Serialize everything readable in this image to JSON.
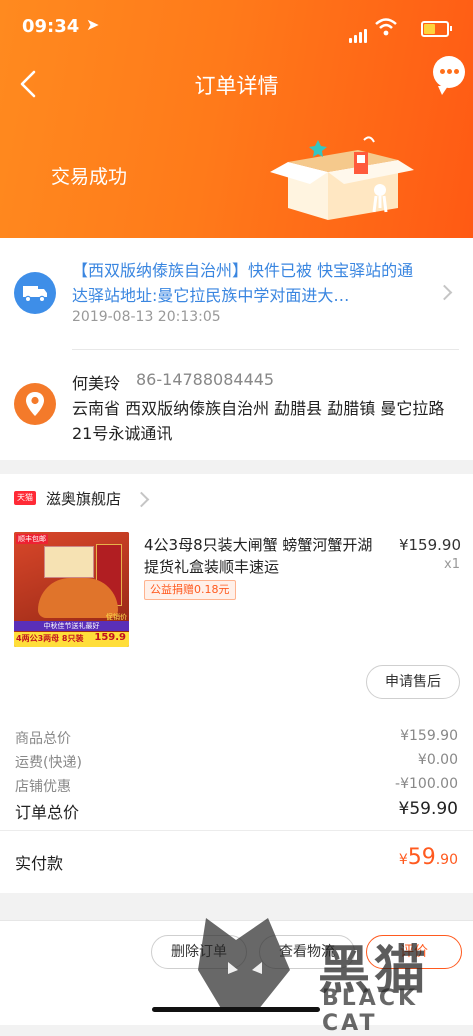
{
  "status_bar": {
    "time": "09:34",
    "location_glyph": "➤"
  },
  "header": {
    "title": "订单详情",
    "deal_status": "交易成功"
  },
  "logistics": {
    "message": "【西双版纳傣族自治州】快件已被 快宝驿站的通达驿站地址:曼它拉民族中学对面进大…",
    "time": "2019-08-13 20:13:05"
  },
  "address": {
    "name": "何美玲",
    "phone": "86-14788084445",
    "detail": "云南省 西双版纳傣族自治州 勐腊县 勐腊镇 曼它拉路21号永诚通讯"
  },
  "shop": {
    "badge": "天猫",
    "name": "滋奥旗舰店",
    "product": {
      "title": "4公3母8只装大闸蟹 螃蟹河蟹开湖提货礼盒装顺丰速运",
      "price": "¥159.90",
      "quantity": "x1",
      "charity": "公益捐赠0.18元",
      "image_texts": {
        "top": "顺丰包邮",
        "promo": "促销价",
        "bottom": "4两公3两母 8只装",
        "price": "159.9",
        "banner": "中秋佳节送礼最好"
      }
    },
    "after_sale_button": "申请售后"
  },
  "summary": {
    "rows": [
      {
        "label": "商品总价",
        "value": "¥159.90"
      },
      {
        "label": "运费(快递)",
        "value": "¥0.00"
      },
      {
        "label": "店铺优惠",
        "value": "-¥100.00"
      }
    ],
    "total_label": "订单总价",
    "total_value": "¥59.90",
    "paid_label": "实付款",
    "paid_symbol": "¥",
    "paid_int": "59",
    "paid_dec": ".90"
  },
  "actions": {
    "delete": "删除订单",
    "logistics": "查看物流",
    "review": "评价"
  },
  "watermark": {
    "cn": "黑猫",
    "en": "BLACK CAT"
  },
  "colors": {
    "accent": "#ff6f1a",
    "price_red": "#ff5a1f",
    "link_blue": "#3a86e0"
  }
}
